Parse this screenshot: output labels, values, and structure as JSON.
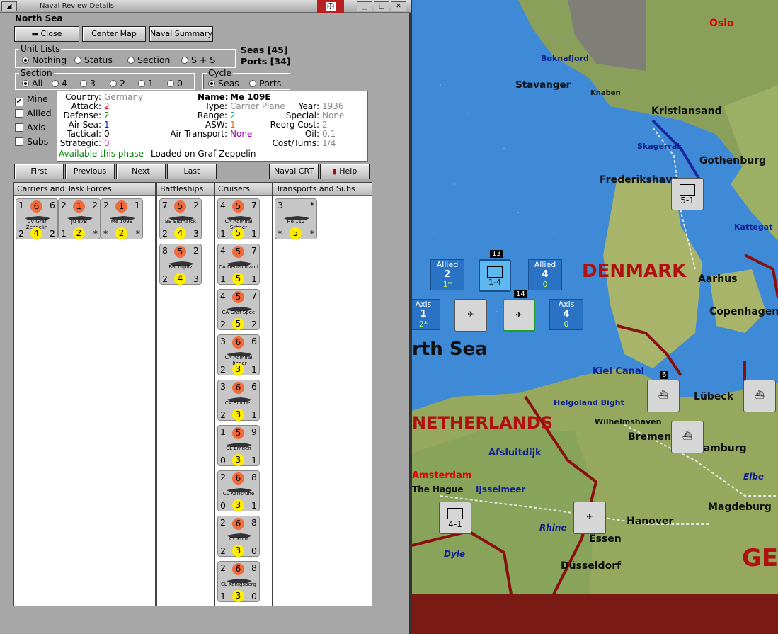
{
  "window": {
    "title": "Naval Review Details",
    "flag_mark": "✠"
  },
  "region": {
    "name": "North Sea"
  },
  "toolbar": {
    "close": "Close",
    "center_map": "Center Map",
    "naval_summary": "Naval Summary"
  },
  "unit_lists": {
    "label": "Unit Lists",
    "options": [
      "Nothing",
      "Status",
      "Section",
      "S + S"
    ],
    "selected": "Nothing"
  },
  "counts": {
    "seas": "Seas [45]",
    "ports": "Ports [34]"
  },
  "section": {
    "label": "Section",
    "options": [
      "All",
      "4",
      "3",
      "2",
      "1",
      "0"
    ],
    "selected": "All"
  },
  "cycle": {
    "label": "Cycle",
    "options": [
      "Seas",
      "Ports"
    ],
    "selected": "Seas"
  },
  "filters": [
    {
      "label": "Mine",
      "checked": true
    },
    {
      "label": "Allied",
      "checked": false
    },
    {
      "label": "Axis",
      "checked": false
    },
    {
      "label": "Subs",
      "checked": false
    }
  ],
  "unit_info": {
    "country_label": "Country:",
    "country": "Germany",
    "attack_label": "Attack:",
    "attack": "2",
    "defense_label": "Defense:",
    "defense": "2",
    "airsea_label": "Air-Sea:",
    "airsea": "1",
    "tactical_label": "Tactical:",
    "tactical": "0",
    "strategic_label": "Strategic:",
    "strategic": "0",
    "name_label": "Name:",
    "name": "Me 109E",
    "type_label": "Type:",
    "type": "Carrier Plane",
    "range_label": "Range:",
    "range": "2",
    "asw_label": "ASW:",
    "asw": "1",
    "air_transport_label": "Air Transport:",
    "air_transport": "None",
    "year_label": "Year:",
    "year": "1936",
    "special_label": "Special:",
    "special": "None",
    "reorg_label": "Reorg Cost:",
    "reorg": "2",
    "oil_label": "Oil:",
    "oil": "0.1",
    "cost_label": "Cost/Turns:",
    "cost": "1/4",
    "availability": "Available this phase",
    "loaded": "Loaded on Graf Zeppelin"
  },
  "nav": {
    "first": "First",
    "previous": "Previous",
    "next": "Next",
    "last": "Last",
    "naval_crt": "Naval CRT",
    "help": "Help"
  },
  "panels": {
    "carriers": "Carriers and Task Forces",
    "battleships": "Battleships",
    "cruisers": "Cruisers",
    "transports": "Transports and Subs"
  },
  "carriers": [
    {
      "tl": "1",
      "mid": "6",
      "tr": "6",
      "bl": "2",
      "ymid": "4",
      "br": "2",
      "name": "CV Graf Zeppelin"
    },
    {
      "tl": "2",
      "mid": "1",
      "tr": "2",
      "bl": "1",
      "ymid": "2",
      "br": "*",
      "name": "Ju 87B"
    },
    {
      "tl": "2",
      "mid": "1",
      "tr": "1",
      "bl": "*",
      "ymid": "2",
      "br": "*",
      "name": "Me 109E"
    }
  ],
  "battleships": [
    {
      "tl": "7",
      "mid": "5",
      "tr": "2",
      "bl": "2",
      "ymid": "4",
      "br": "3",
      "name": "BB Bismarck"
    },
    {
      "tl": "8",
      "mid": "5",
      "tr": "2",
      "bl": "2",
      "ymid": "4",
      "br": "3",
      "name": "BB Tirpitz"
    }
  ],
  "cruisers": [
    {
      "tl": "4",
      "mid": "5",
      "tr": "7",
      "bl": "1",
      "ymid": "5",
      "br": "1",
      "name": "CA Admiral Scheer"
    },
    {
      "tl": "4",
      "mid": "5",
      "tr": "7",
      "bl": "1",
      "ymid": "5",
      "br": "1",
      "name": "CA Deutschland"
    },
    {
      "tl": "4",
      "mid": "5",
      "tr": "7",
      "bl": "2",
      "ymid": "5",
      "br": "2",
      "name": "CA Graf Spee"
    },
    {
      "tl": "3",
      "mid": "6",
      "tr": "6",
      "bl": "2",
      "ymid": "3",
      "br": "1",
      "name": "CA Admiral Hipper"
    },
    {
      "tl": "3",
      "mid": "6",
      "tr": "6",
      "bl": "2",
      "ymid": "3",
      "br": "1",
      "name": "CA Blücher"
    },
    {
      "tl": "1",
      "mid": "5",
      "tr": "9",
      "bl": "0",
      "ymid": "3",
      "br": "1",
      "name": "CL Emden"
    },
    {
      "tl": "2",
      "mid": "6",
      "tr": "8",
      "bl": "0",
      "ymid": "3",
      "br": "1",
      "name": "CL Karlsruhe"
    },
    {
      "tl": "2",
      "mid": "6",
      "tr": "8",
      "bl": "2",
      "ymid": "3",
      "br": "0",
      "name": "CL Köln"
    },
    {
      "tl": "2",
      "mid": "6",
      "tr": "8",
      "bl": "1",
      "ymid": "3",
      "br": "0",
      "name": "CL Königsberg"
    }
  ],
  "transports": [
    {
      "tl": "3",
      "mid": "",
      "tr": "*",
      "bl": "*",
      "ymid": "5",
      "br": "*",
      "name": "He 112"
    }
  ],
  "map": {
    "cities": [
      "Oslo",
      "Stavanger",
      "Kristiansand",
      "Gothenburg",
      "Frederikshavn",
      "Aarhus",
      "Copenhagen",
      "Lübeck",
      "Bremen",
      "Hamburg",
      "Hanover",
      "Magdeburg",
      "Essen",
      "Düsseldorf",
      "The Hague",
      "Amsterdam",
      "IJsselmeer",
      "Wilhelmshaven",
      "Knaben"
    ],
    "waters": [
      "Boknafjord",
      "Skagerrak",
      "Kattegat",
      "Kiel Canal",
      "Helgoland Bight",
      "Afsluitdijk",
      "Elbe",
      "Rhine",
      "Dyle"
    ],
    "countries": [
      "DENMARK",
      "NETHERLANDS",
      "GE"
    ],
    "sea_name": "rth Sea",
    "allied_box_1": {
      "label": "Allied",
      "value": "2",
      "sub": "1*"
    },
    "allied_box_2": {
      "label": "Allied",
      "value": "4",
      "sub": "0"
    },
    "axis_box_1": {
      "label": "Axis",
      "value": "1",
      "sub": "2*"
    },
    "axis_box_2": {
      "label": "Axis",
      "value": "4",
      "sub": "0"
    },
    "stack_13": "13",
    "stack_14": "14",
    "corps_1": "1-4",
    "corps_2": "5-1",
    "corps_3": "4-1",
    "hex_6": "6"
  }
}
